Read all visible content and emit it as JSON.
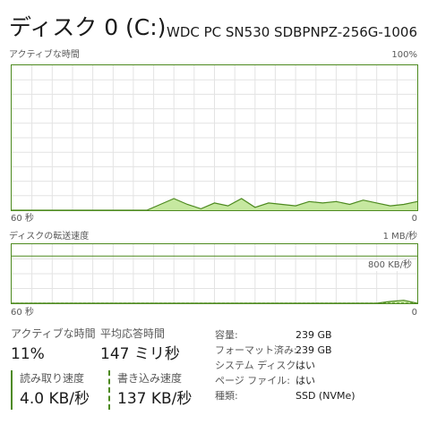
{
  "header": {
    "title": "ディスク 0 (C:)",
    "model": "WDC PC SN530 SDBPNPZ-256G-1006"
  },
  "active_chart": {
    "label": "アクティブな時間",
    "max_label": "100%",
    "time_label": "60 秒",
    "min_label": "0",
    "colors": {
      "line": "#4d8a1f",
      "fill": "#c6e8a0",
      "grid": "#e3e3e3"
    }
  },
  "transfer_chart": {
    "label": "ディスクの転送速度",
    "max_label": "1 MB/秒",
    "ref_label": "800 KB/秒",
    "time_label": "60 秒",
    "min_label": "0"
  },
  "stats": {
    "active_time": {
      "label": "アクティブな時間",
      "value": "11%"
    },
    "avg_response": {
      "label": "平均応答時間",
      "value": "147 ミリ秒"
    },
    "read_speed": {
      "label": "読み取り速度",
      "value": "4.0 KB/秒"
    },
    "write_speed": {
      "label": "書き込み速度",
      "value": "137 KB/秒"
    }
  },
  "properties": [
    {
      "key": "容量:",
      "value": "239 GB"
    },
    {
      "key": "フォーマット済み:",
      "value": "239 GB"
    },
    {
      "key": "システム ディスク:",
      "value": "はい"
    },
    {
      "key": "ページ ファイル:",
      "value": "はい"
    },
    {
      "key": "種類:",
      "value": "SSD (NVMe)"
    }
  ],
  "chart_data": [
    {
      "type": "area",
      "title": "アクティブな時間",
      "x_label": "60 秒",
      "ylim": [
        0,
        100
      ],
      "x": [
        -60,
        -50,
        -45,
        -40,
        -38,
        -36,
        -34,
        -32,
        -30,
        -28,
        -26,
        -24,
        -22,
        -20,
        -18,
        -16,
        -14,
        -12,
        -10,
        -8,
        -6,
        -4,
        -2,
        0
      ],
      "values": [
        0,
        0,
        0,
        0,
        4,
        8,
        4,
        1,
        5,
        3,
        8,
        2,
        5,
        4,
        3,
        6,
        5,
        6,
        4,
        7,
        5,
        3,
        4,
        6
      ]
    },
    {
      "type": "line",
      "title": "ディスクの転送速度",
      "x_label": "60 秒",
      "ylim": [
        0,
        1000
      ],
      "y_unit": "KB/秒",
      "x": [
        -60,
        -58,
        -56,
        -54,
        -52,
        -50,
        -48,
        -46,
        -44,
        -42,
        -40,
        -38,
        -36,
        -34,
        -32,
        -30,
        -28,
        -26,
        -24,
        -22,
        -20,
        -18,
        -16,
        -14,
        -12,
        -10,
        -8,
        -6,
        -4,
        -2,
        0
      ],
      "series": [
        {
          "style": "solid",
          "values": [
            0,
            0,
            0,
            0,
            0,
            0,
            0,
            0,
            0,
            0,
            0,
            0,
            0,
            0,
            0,
            0,
            0,
            0,
            0,
            0,
            0,
            0,
            0,
            0,
            0,
            0,
            0,
            0,
            30,
            50,
            0
          ]
        },
        {
          "style": "dashed",
          "values": [
            0,
            0,
            0,
            0,
            0,
            0,
            0,
            0,
            0,
            0,
            0,
            0,
            0,
            0,
            0,
            0,
            0,
            0,
            0,
            0,
            0,
            0,
            0,
            0,
            0,
            0,
            0,
            0,
            0,
            0,
            0
          ]
        }
      ]
    }
  ]
}
